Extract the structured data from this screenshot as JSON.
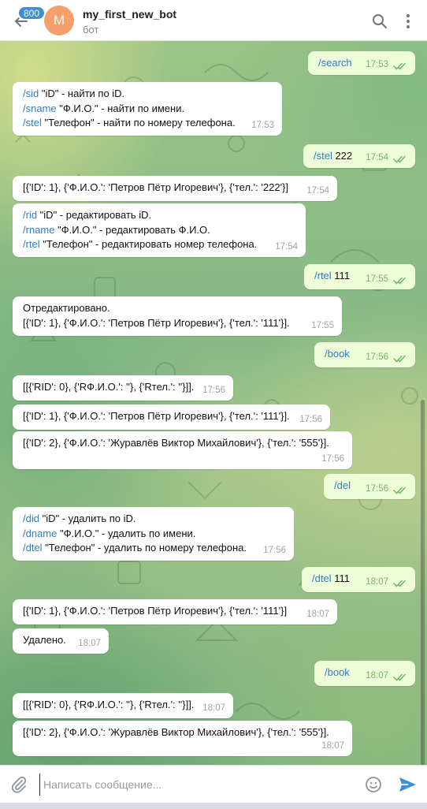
{
  "header": {
    "unread_badge": "800",
    "avatar_letter": "M",
    "title": "my_first_new_bot",
    "subtitle": "бот"
  },
  "messages": [
    {
      "dir": "out",
      "lines": [
        [
          {
            "t": "/search",
            "cmd": true
          }
        ]
      ],
      "time": "17:53"
    },
    {
      "dir": "in",
      "lines": [
        [
          {
            "t": "/sid",
            "cmd": true
          },
          {
            "t": " \"iD\" - найти по iD."
          }
        ],
        [
          {
            "t": "/sname",
            "cmd": true
          },
          {
            "t": " \"Ф.И.О.\" - найти по имени."
          }
        ],
        [
          {
            "t": "/stel",
            "cmd": true
          },
          {
            "t": " \"Телефон\" - найти по номеру телефона."
          }
        ]
      ],
      "time": "17:53"
    },
    {
      "dir": "out",
      "lines": [
        [
          {
            "t": "/stel",
            "cmd": true
          },
          {
            "t": " 222"
          }
        ]
      ],
      "time": "17:54"
    },
    {
      "dir": "in",
      "lines": [
        [
          {
            "t": "[{'ID': 1}, {'Ф.И.О.': 'Петров Пётр Игоревич'}, {'тел.': '222'}]"
          }
        ]
      ],
      "time": "17:54"
    },
    {
      "dir": "in",
      "lines": [
        [
          {
            "t": "/rid",
            "cmd": true
          },
          {
            "t": " \"iD\" - редактировать iD."
          }
        ],
        [
          {
            "t": "/rname",
            "cmd": true
          },
          {
            "t": " \"Ф.И.О.\" - редактировать Ф.И.О."
          }
        ],
        [
          {
            "t": "/rtel",
            "cmd": true
          },
          {
            "t": " \"Телефон\" - редактировать номер телефона."
          }
        ]
      ],
      "time": "17:54"
    },
    {
      "dir": "out",
      "lines": [
        [
          {
            "t": "/rtel",
            "cmd": true
          },
          {
            "t": " 111"
          }
        ]
      ],
      "time": "17:55"
    },
    {
      "dir": "in",
      "lines": [
        [
          {
            "t": "Отредактировано."
          }
        ],
        [
          {
            "t": " [{'ID': 1}, {'Ф.И.О.': 'Петров Пётр Игоревич'}, {'тел.': '111'}]."
          }
        ]
      ],
      "time": "17:55"
    },
    {
      "dir": "out",
      "lines": [
        [
          {
            "t": "/book",
            "cmd": true
          }
        ]
      ],
      "time": "17:56"
    },
    {
      "dir": "in",
      "lines": [
        [
          {
            "t": "[[{'RID': 0}, {'RФ.И.О.': ''}, {'Rтел.': ''}]]."
          }
        ]
      ],
      "time": "17:56"
    },
    {
      "dir": "in",
      "lines": [
        [
          {
            "t": "[{'ID': 1}, {'Ф.И.О.': 'Петров Пётр Игоревич'}, {'тел.': '111'}]."
          }
        ]
      ],
      "time": "17:56"
    },
    {
      "dir": "in",
      "lines": [
        [
          {
            "t": "[{'ID': 2}, {'Ф.И.О.': 'Журавлёв Виктор Михайлович'}, {'тел.': '555'}]."
          }
        ]
      ],
      "time": "17:56"
    },
    {
      "dir": "out",
      "lines": [
        [
          {
            "t": "/del",
            "cmd": true
          }
        ]
      ],
      "time": "17:56"
    },
    {
      "dir": "in",
      "lines": [
        [
          {
            "t": "/did",
            "cmd": true
          },
          {
            "t": " \"iD\" - удалить по iD."
          }
        ],
        [
          {
            "t": "/dname",
            "cmd": true
          },
          {
            "t": " \"Ф.И.О.\" - удалить по имени."
          }
        ],
        [
          {
            "t": "/dtel",
            "cmd": true
          },
          {
            "t": " \"Телефон\" - удалить по номеру телефона."
          }
        ]
      ],
      "time": "17:56"
    },
    {
      "dir": "out",
      "lines": [
        [
          {
            "t": "/dtel",
            "cmd": true
          },
          {
            "t": " 111"
          }
        ]
      ],
      "time": "18:07"
    },
    {
      "dir": "in",
      "lines": [
        [
          {
            "t": "[{'ID': 1}, {'Ф.И.О.': 'Петров Пётр Игоревич'}, {'тел.': '111'}]"
          }
        ]
      ],
      "time": "18:07"
    },
    {
      "dir": "in",
      "lines": [
        [
          {
            "t": "Удалено."
          }
        ]
      ],
      "time": "18:07"
    },
    {
      "dir": "out",
      "lines": [
        [
          {
            "t": "/book",
            "cmd": true
          }
        ]
      ],
      "time": "18:07"
    },
    {
      "dir": "in",
      "lines": [
        [
          {
            "t": "[[{'RID': 0}, {'RФ.И.О.': ''}, {'Rтел.': ''}]]."
          }
        ]
      ],
      "time": "18:07"
    },
    {
      "dir": "in",
      "lines": [
        [
          {
            "t": "[{'ID': 2}, {'Ф.И.О.': 'Журавлёв Виктор Михайлович'}, {'тел.': '555'}]."
          }
        ]
      ],
      "time": "18:07"
    }
  ],
  "composer": {
    "placeholder": "Написать сообщение..."
  },
  "colors": {
    "accent": "#3d8fd6",
    "command_link": "#2f7ec1",
    "outgoing_bubble": "#eefed9",
    "read_check": "#6fb463"
  }
}
